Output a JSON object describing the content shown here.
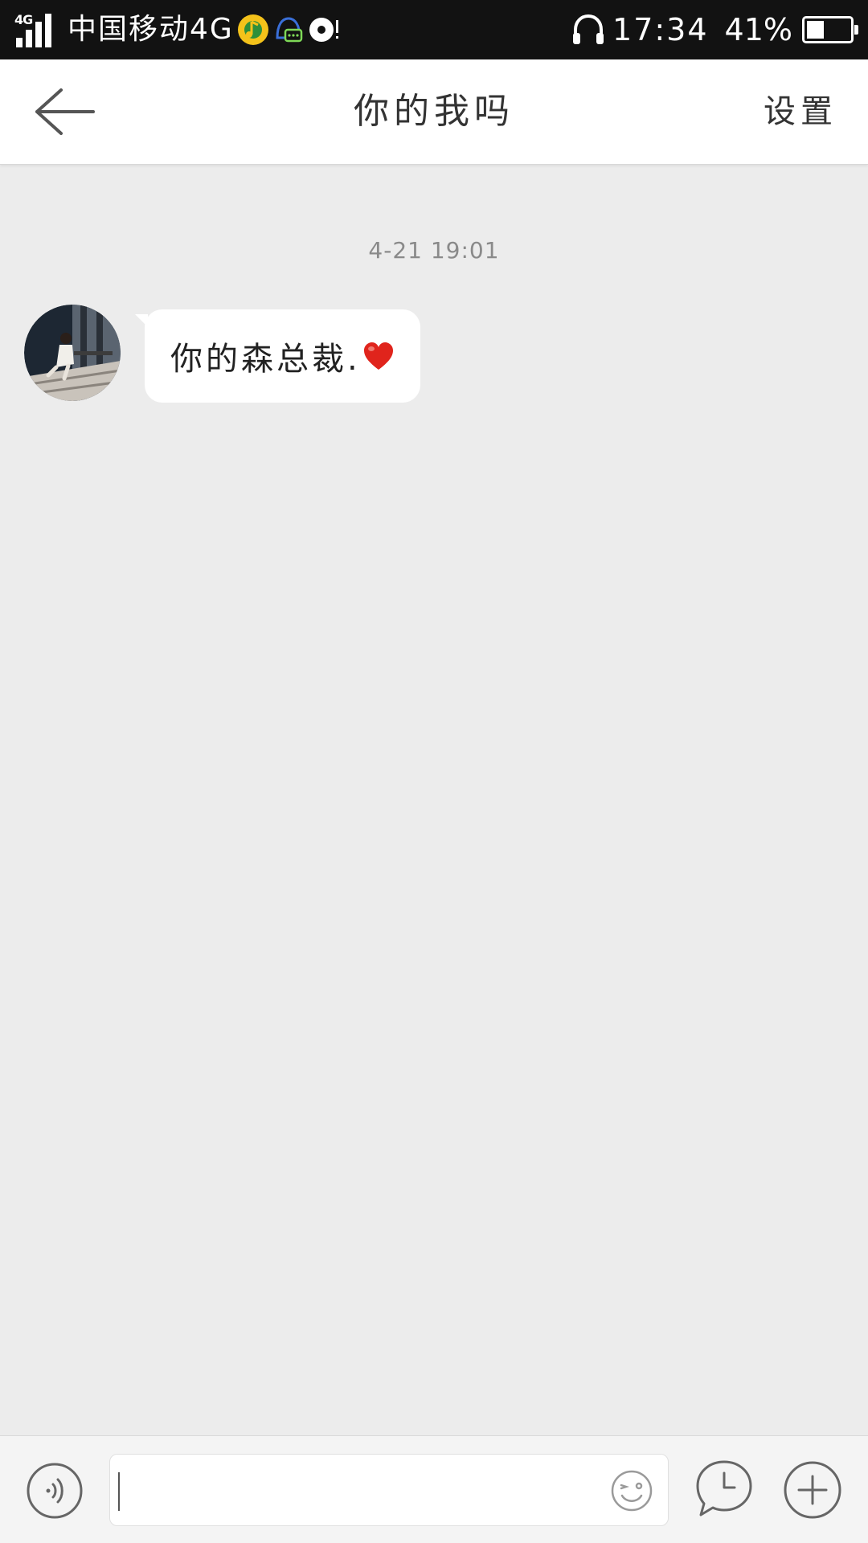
{
  "status_bar": {
    "network": "4G",
    "carrier": "中国移动4G",
    "time": "17:34",
    "battery_percent": "41%",
    "battery_level": 0.41
  },
  "header": {
    "title": "你的我吗",
    "settings_label": "设置"
  },
  "chat": {
    "messages": [
      {
        "timestamp": "4-21 19:01",
        "direction": "incoming",
        "text": "你的森总裁.",
        "emoji": "heart-icon"
      }
    ]
  },
  "input_bar": {
    "value": "",
    "placeholder": ""
  },
  "icons": {
    "back": "back-arrow-icon",
    "voice": "voice-icon",
    "emoji": "emoji-icon",
    "clock": "clock-bubble-icon",
    "plus": "plus-icon",
    "headphone": "headphone-icon",
    "music": "music-app-icon",
    "chat_notification": "chat-notification-icon",
    "media": "media-disc-icon"
  },
  "colors": {
    "status_bar_bg": "#121212",
    "chat_bg": "#ececec",
    "bubble_bg": "#ffffff",
    "heart": "#e0241c",
    "music_icon": "#f4c21a"
  }
}
